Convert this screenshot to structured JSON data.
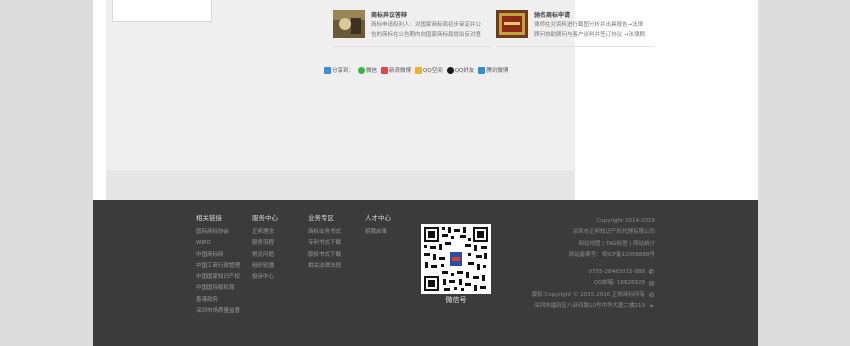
{
  "cards": [
    {
      "title": "商标异议答辩",
      "desc1": "商标申请权利人：对国家商标局初步审定并公",
      "desc2": "告的商标在公告期内向国家商标局提出反对意"
    },
    {
      "title": "驰名商标申请",
      "desc1": "律师在对资料进行截图分析并出具报告→法律",
      "desc2": "顾问协助顾问与客户谈判并签订协议 →法律顾"
    }
  ],
  "share": {
    "label": "分享到：",
    "items": [
      {
        "label": "微信",
        "color": "#38b538"
      },
      {
        "label": "新浪微博",
        "color": "#e64545"
      },
      {
        "label": "QQ空间",
        "color": "#e8b52b"
      },
      {
        "label": "QQ好友",
        "color": "#1a1a1a"
      },
      {
        "label": "腾讯微博",
        "color": "#2c8fd6"
      }
    ]
  },
  "footer": {
    "cols": [
      {
        "title": "相关链接",
        "links": [
          "国际商标协会",
          "WIPO",
          "中国商标网",
          "中国工商行政管理",
          "中国国家知识产权",
          "中国国际版权局",
          "香港政府",
          "深圳市场质量监督"
        ]
      },
      {
        "title": "服务中心",
        "links": [
          "正邦理念",
          "服务流程",
          "常见问题",
          "组织轮播",
          "投诉中心"
        ]
      },
      {
        "title": "业务专区",
        "links": [
          "商标业务书式",
          "专利书式下载",
          "版权书式下载",
          "相关法律法规"
        ]
      },
      {
        "title": "人才中心",
        "links": [
          "招聘启事"
        ]
      }
    ],
    "qr_label": "微信号",
    "right": {
      "copyright": "Copyright 2014-2018",
      "company": "深圳市正邦知识产权代理有限公司",
      "nav": "网站地图 | TAG标签 | 网站统计",
      "icp": "网站备案号：粤ICP备12058888号",
      "phone": "0755-28483015-888",
      "qq": "QQ邮箱: 16628928",
      "rights": "版权:Copyright © 2015-2016 正邦商标所有",
      "address": "深圳市福田区八卦四路10号中华大厦二楼219"
    }
  }
}
